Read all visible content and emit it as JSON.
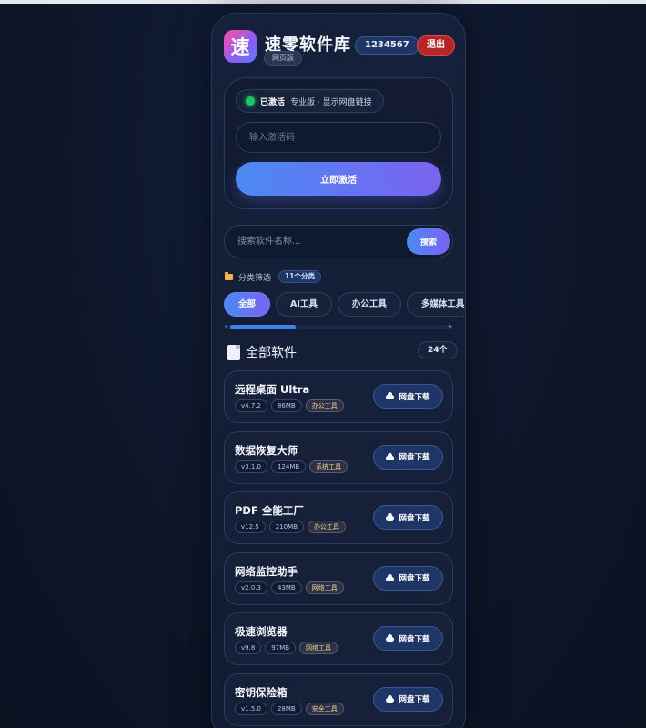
{
  "header": {
    "logo_char": "速",
    "app_title": "速零软件库",
    "version_tag": "网页版",
    "user_id": "1234567",
    "logout_label": "退出"
  },
  "activation": {
    "status_strong": "已激活",
    "status_detail": "专业版 · 显示网盘链接",
    "code_placeholder": "输入激活码",
    "code_value": "",
    "activate_label": "立即激活",
    "status_color": "#22c55e"
  },
  "search": {
    "placeholder": "搜索软件名称...",
    "button_label": "搜索"
  },
  "filter": {
    "label": "分类筛选",
    "count": "11个分类",
    "categories": [
      {
        "label": "全部",
        "active": true
      },
      {
        "label": "AI工具",
        "active": false
      },
      {
        "label": "办公工具",
        "active": false
      },
      {
        "label": "多媒体工具",
        "active": false
      }
    ]
  },
  "section": {
    "title": "全部软件",
    "count": "24个"
  },
  "download_label": "网盘下载",
  "software": [
    {
      "name": "远程桌面 Ultra",
      "version": "v4.7.2",
      "size": "86MB",
      "category": "办公工具"
    },
    {
      "name": "数据恢复大师",
      "version": "v3.1.0",
      "size": "124MB",
      "category": "系统工具"
    },
    {
      "name": "PDF 全能工厂",
      "version": "v12.5",
      "size": "210MB",
      "category": "办公工具"
    },
    {
      "name": "网络监控助手",
      "version": "v2.0.3",
      "size": "43MB",
      "category": "网络工具"
    },
    {
      "name": "极速浏览器",
      "version": "v9.8",
      "size": "97MB",
      "category": "网络工具"
    },
    {
      "name": "密钥保险箱",
      "version": "v1.5.0",
      "size": "28MB",
      "category": "安全工具"
    }
  ],
  "colors": {
    "accent_start": "#4a8af4",
    "accent_end": "#7b63f0",
    "logout": "#b3262c",
    "background": "#0d1528"
  }
}
